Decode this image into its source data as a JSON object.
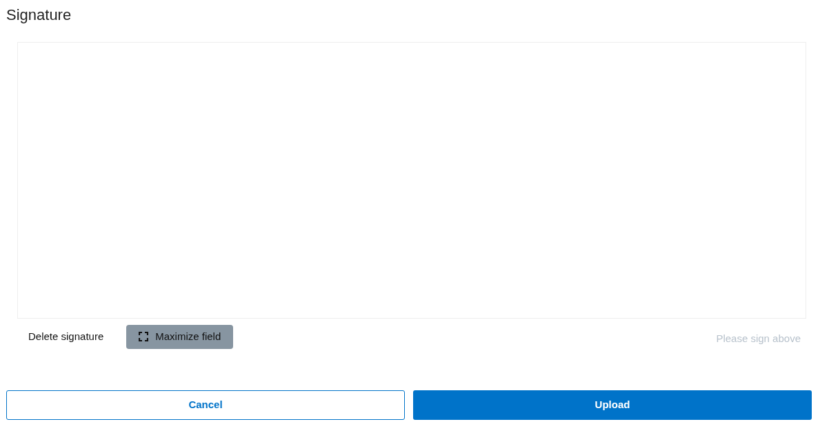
{
  "title": "Signature",
  "signature_pad": {
    "hint": "Please sign above"
  },
  "actions": [
    {
      "label": "Delete signature",
      "kind": "link"
    },
    {
      "label": "Maximize field",
      "kind": "maximize"
    }
  ],
  "buttons": [
    {
      "label": "Cancel",
      "kind": "secondary"
    },
    {
      "label": "Upload",
      "kind": "primary"
    }
  ]
}
